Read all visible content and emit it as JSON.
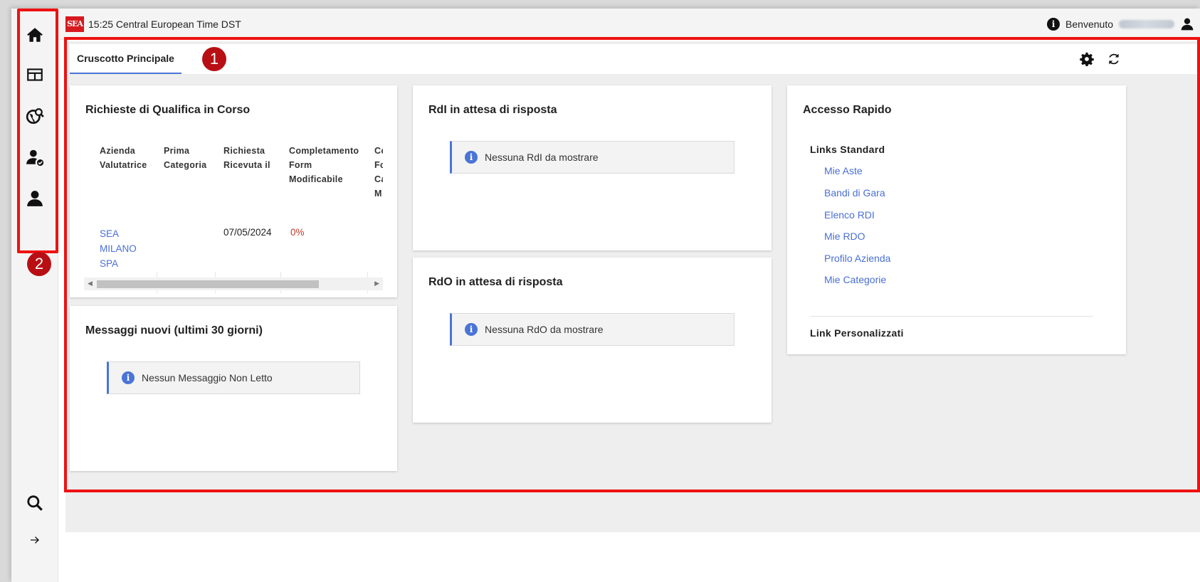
{
  "topbar": {
    "logo_text": "SEA",
    "time": "15:25 Central European Time DST",
    "welcome_label": "Benvenuto"
  },
  "sidebar": {
    "items": [
      {
        "icon": "home-icon"
      },
      {
        "icon": "dashboard-icon"
      },
      {
        "icon": "globe-search-icon"
      },
      {
        "icon": "user-check-icon"
      },
      {
        "icon": "user-icon"
      }
    ],
    "bottom": [
      {
        "icon": "search-icon"
      },
      {
        "icon": "arrow-right-icon"
      }
    ]
  },
  "markers": [
    "1",
    "2"
  ],
  "tabs": [
    {
      "label": "Cruscotto Principale",
      "active": true
    }
  ],
  "toolbar": [
    "gear-icon",
    "refresh-icon"
  ],
  "qualifica": {
    "title": "Richieste di Qualifica in Corso",
    "headers": [
      [
        "Azienda",
        "Valutatrice"
      ],
      [
        "Prima",
        "Categoria"
      ],
      [
        "Richiesta",
        "Ricevuta il"
      ],
      [
        "Completamento",
        "Form",
        "Modificabile"
      ],
      [
        "Co",
        "Fo",
        "Ca",
        "M"
      ]
    ],
    "rows": [
      {
        "azienda": [
          "SEA",
          "MILANO",
          "SPA"
        ],
        "categoria": "",
        "data": "07/05/2024",
        "completamento": "0%"
      }
    ]
  },
  "messaggi": {
    "title": "Messaggi nuovi (ultimi 30 giorni)",
    "notice": "Nessun Messaggio Non Letto"
  },
  "rdi": {
    "title": "RdI in attesa di risposta",
    "notice": "Nessuna RdI da mostrare"
  },
  "rdo": {
    "title": "RdO in attesa di risposta",
    "notice": "Nessuna RdO da mostrare"
  },
  "accesso": {
    "title": "Accesso Rapido",
    "standard_heading": "Links Standard",
    "links": [
      "Mie Aste",
      "Bandi di Gara",
      "Elenco RDI",
      "Mie RDO",
      "Profilo Azienda",
      "Mie Categorie"
    ],
    "custom_heading": "Link Personalizzati"
  },
  "colors": {
    "accent": "#4a74d6",
    "link": "#4a6fd6",
    "highlight": "#ee1111",
    "marker": "#b80f14",
    "percent": "#c0392b",
    "brand": "#d7191f"
  }
}
